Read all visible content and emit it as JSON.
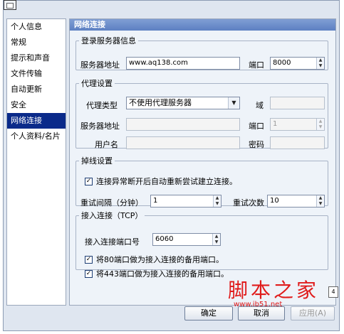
{
  "sidebar": {
    "items": [
      {
        "label": "个人信息"
      },
      {
        "label": "常规"
      },
      {
        "label": "提示和声音"
      },
      {
        "label": "文件传输"
      },
      {
        "label": "自动更新"
      },
      {
        "label": "安全"
      },
      {
        "label": "网络连接",
        "active": true
      },
      {
        "label": "个人资料/名片"
      }
    ]
  },
  "panel": {
    "title": "网络连接",
    "login_server": {
      "legend": "登录服务器信息",
      "address_label": "服务器地址",
      "address_value": "www.aq138.com",
      "port_label": "端口",
      "port_value": "8000"
    },
    "proxy": {
      "legend": "代理设置",
      "type_label": "代理类型",
      "type_value": "不使用代理服务器",
      "domain_label": "域",
      "address_label": "服务器地址",
      "port_label": "端口",
      "port_value": "1",
      "username_label": "用户名",
      "password_label": "密码"
    },
    "disconnect": {
      "legend": "掉线设置",
      "auto_reconnect_label": "连接异常断开后自动重新尝试建立连接。",
      "auto_reconnect_checked": true,
      "interval_label": "重试间隔（分钟）",
      "interval_value": "1",
      "retries_label": "重试次数",
      "retries_value": "10"
    },
    "incoming": {
      "legend": "接入连接（TCP）",
      "port_label": "接入连接端口号",
      "port_value": "6060",
      "use80_label": "将80端口做为接入连接的备用端口。",
      "use80_checked": true,
      "use443_label": "将443端口做为接入连接的备用端口。",
      "use443_checked": true
    }
  },
  "buttons": {
    "ok": "确定",
    "cancel": "取消",
    "apply": "应用(A)"
  },
  "watermark": {
    "title": "脚本之家",
    "url": "www.jb51.net"
  },
  "side_tag": "4"
}
